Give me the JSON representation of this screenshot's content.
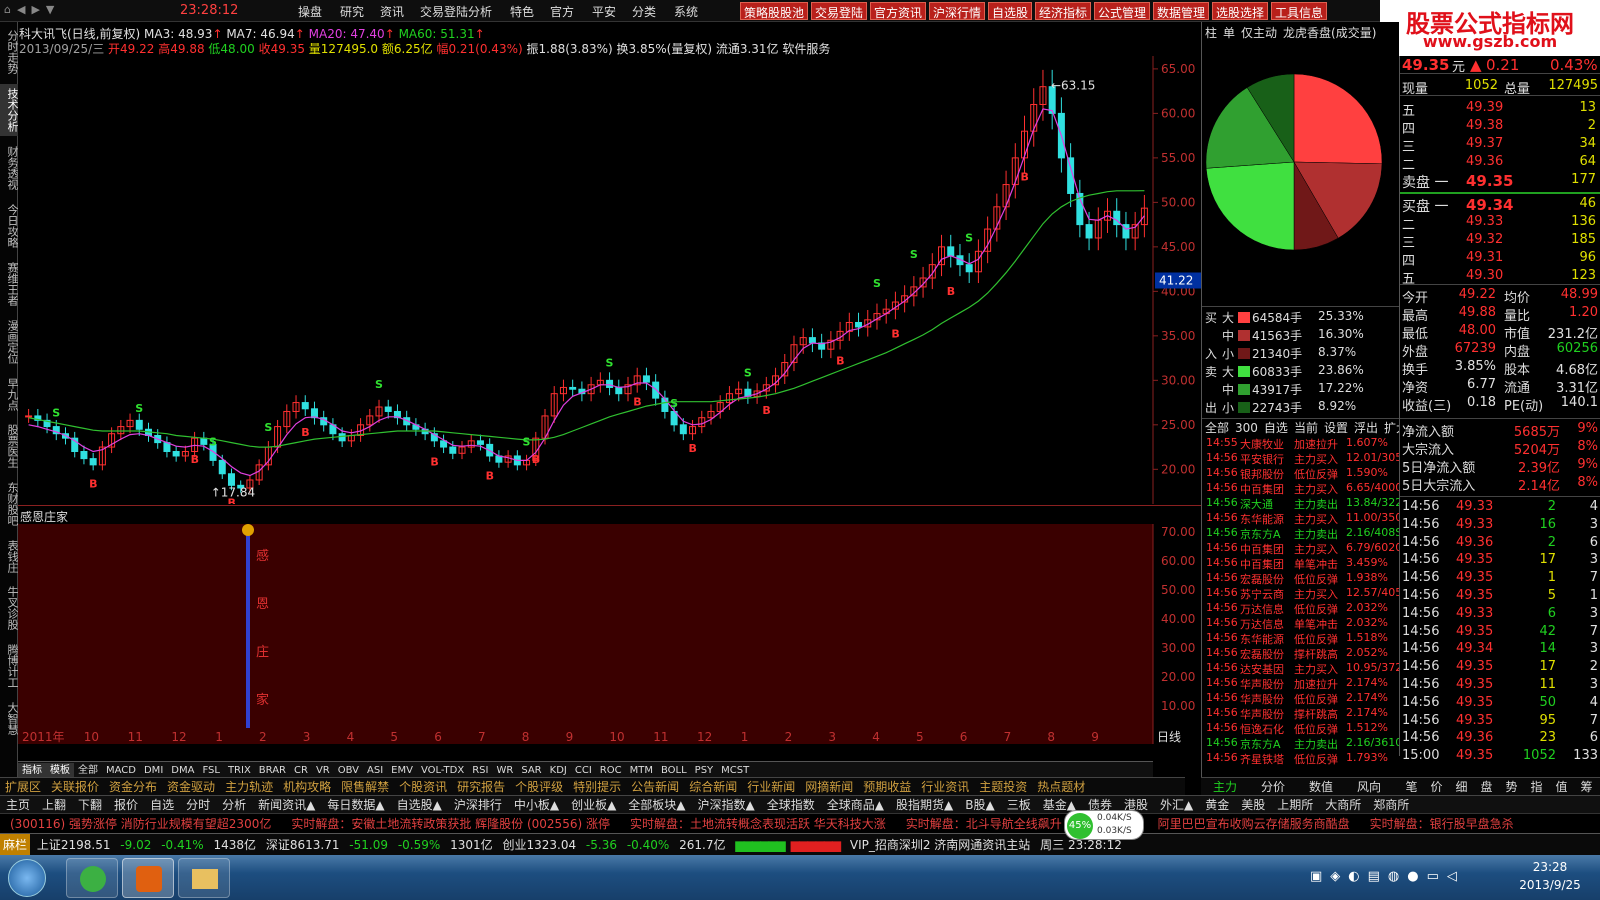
{
  "menubar": {
    "clock": "23:28:12",
    "items": [
      "操盘",
      "研究",
      "资讯",
      "交易登陆分析",
      "特色",
      "官方",
      "平安",
      "分类",
      "系统"
    ],
    "tools": [
      "策略股股池",
      "交易登陆",
      "官方资讯",
      "沪深行情",
      "自选股",
      "经济指标",
      "公式管理",
      "数据管理",
      "选股选择",
      "工具信息"
    ]
  },
  "watermark": {
    "line1": "股票公式指标网",
    "line2": "www.gszb.com"
  },
  "left_tabs": [
    "分时走势",
    "技术分析",
    "财务透视",
    "今日攻略",
    "赛维王者",
    "漫画定位",
    "早九点",
    "股票医生",
    "东财股吧",
    "表钱庄",
    "牛叉诊股",
    "腾博计工",
    "大智慧"
  ],
  "stock": {
    "title": "科大讯飞(日线,前复权)",
    "ma3": "MA3: 48.93",
    "ma7": "MA7: 46.94",
    "ma20": "MA20: 47.40",
    "ma60": "MA60: 51.31",
    "date": "2013/09/25/三",
    "open": "开49.22",
    "high": "高49.88",
    "low": "低48.00",
    "close": "收49.35",
    "volume": "量127495.0",
    "amount": "额6.25亿",
    "range": "幅0.21(0.43%)",
    "extra": "振1.88(3.83%) 换3.85%(量复权) 流通3.31亿 软件服务"
  },
  "chart_data": {
    "type": "line",
    "title": "科大讯飞(日线,前复权)",
    "y_ticks": [
      "65.00",
      "60.00",
      "55.00",
      "50.00",
      "45.00",
      "40.00",
      "35.00",
      "30.00",
      "25.00",
      "20.00"
    ],
    "ylim": [
      17,
      66
    ],
    "x_labels": [
      "2011年",
      "10",
      "11",
      "12",
      "1",
      "2",
      "3",
      "4",
      "5",
      "6",
      "7",
      "8",
      "9",
      "10",
      "11",
      "12",
      "1",
      "2",
      "3",
      "4",
      "5",
      "6",
      "7",
      "8",
      "9"
    ],
    "max_label": "63.15",
    "min_label": "17.84",
    "current_price": "41.22",
    "close_series": [
      26.0,
      25.5,
      24.8,
      24.0,
      23.5,
      22.0,
      21.2,
      20.5,
      22.5,
      24.0,
      24.8,
      25.5,
      24.5,
      23.8,
      23.0,
      22.0,
      21.5,
      22.0,
      23.5,
      22.8,
      21.0,
      19.5,
      18.2,
      17.9,
      18.8,
      20.5,
      22.5,
      24.8,
      26.5,
      27.5,
      26.8,
      25.8,
      25.0,
      24.0,
      23.2,
      23.8,
      25.0,
      26.0,
      27.0,
      26.5,
      25.8,
      25.0,
      24.5,
      24.0,
      23.2,
      22.5,
      21.8,
      22.5,
      23.2,
      22.8,
      21.5,
      20.8,
      21.5,
      20.5,
      21.0,
      23.5,
      26.0,
      28.5,
      29.2,
      29.0,
      28.5,
      29.5,
      30.0,
      29.2,
      28.5,
      29.5,
      30.5,
      29.8,
      28.0,
      26.5,
      25.0,
      24.0,
      24.8,
      25.8,
      26.5,
      27.5,
      28.5,
      29.0,
      28.2,
      28.8,
      29.5,
      30.5,
      32.0,
      34.0,
      34.8,
      34.2,
      33.5,
      34.5,
      35.5,
      36.5,
      36.0,
      36.8,
      37.5,
      38.0,
      38.8,
      39.5,
      40.5,
      41.5,
      43.0,
      45.0,
      44.0,
      43.0,
      42.2,
      44.5,
      47.0,
      49.5,
      52.0,
      55.0,
      58.0,
      61.0,
      63.0,
      60.0,
      55.0,
      51.0,
      47.5,
      46.0,
      48.0,
      49.0,
      47.5,
      46.0,
      47.5,
      49.35
    ],
    "ma_series": [
      25.0,
      24.8,
      24.5,
      24.2,
      23.8,
      23.2,
      22.5,
      22.0,
      22.2,
      22.8,
      23.4,
      23.9,
      24.0,
      23.8,
      23.4,
      23.0,
      22.6,
      22.5,
      22.7,
      22.6,
      22.0,
      21.2,
      20.3,
      19.6,
      19.3,
      19.8,
      20.9,
      22.4,
      23.9,
      25.1,
      25.8,
      25.9,
      25.6,
      25.0,
      24.3,
      24.1,
      24.3,
      24.8,
      25.5,
      25.9,
      25.9,
      25.5,
      25.0,
      24.5,
      23.9,
      23.3,
      22.7,
      22.6,
      22.7,
      22.6,
      22.1,
      21.5,
      21.3,
      21.0,
      21.0,
      21.9,
      23.5,
      25.5,
      27.2,
      28.2,
      28.6,
      29.0,
      29.5,
      29.5,
      29.2,
      29.3,
      29.7,
      29.7,
      29.0,
      27.9,
      26.6,
      25.4,
      25.0,
      25.1,
      25.6,
      26.4,
      27.3,
      28.0,
      28.2,
      28.5,
      29.0,
      29.7,
      30.8,
      32.3,
      33.6,
      34.2,
      34.1,
      34.3,
      34.8,
      35.6,
      35.8,
      36.3,
      36.9,
      37.5,
      38.2,
      38.9,
      39.8,
      40.8,
      42.0,
      43.6,
      44.0,
      43.6,
      43.1,
      43.6,
      45.2,
      47.3,
      49.6,
      52.3,
      55.2,
      58.2,
      60.5,
      60.3,
      57.5,
      53.9,
      50.4,
      48.1,
      48.0,
      48.5,
      48.0,
      47.0,
      47.2,
      48.5
    ],
    "ma60_series": [
      25.8,
      25.6,
      25.4,
      25.2,
      25.0,
      24.8,
      24.6,
      24.4,
      24.3,
      24.3,
      24.3,
      24.3,
      24.3,
      24.2,
      24.1,
      24.0,
      23.8,
      23.7,
      23.6,
      23.5,
      23.4,
      23.2,
      23.0,
      22.8,
      22.6,
      22.5,
      22.5,
      22.6,
      22.8,
      23.0,
      23.2,
      23.4,
      23.5,
      23.6,
      23.7,
      23.8,
      23.9,
      24.0,
      24.1,
      24.2,
      24.3,
      24.3,
      24.3,
      24.3,
      24.3,
      24.2,
      24.1,
      24.0,
      23.9,
      23.8,
      23.7,
      23.6,
      23.5,
      23.4,
      23.3,
      23.3,
      23.4,
      23.6,
      23.9,
      24.3,
      24.7,
      25.1,
      25.5,
      25.9,
      26.2,
      26.5,
      26.8,
      27.1,
      27.3,
      27.5,
      27.6,
      27.6,
      27.6,
      27.6,
      27.6,
      27.7,
      27.8,
      27.9,
      28.0,
      28.1,
      28.3,
      28.5,
      28.8,
      29.1,
      29.5,
      29.9,
      30.3,
      30.7,
      31.1,
      31.5,
      31.9,
      32.3,
      32.7,
      33.1,
      33.6,
      34.1,
      34.6,
      35.1,
      35.7,
      36.4,
      37.0,
      37.6,
      38.2,
      38.9,
      39.8,
      40.9,
      42.1,
      43.4,
      44.8,
      46.2,
      47.6,
      48.7,
      49.5,
      50.1,
      50.5,
      50.8,
      51.0,
      51.2,
      51.3,
      51.3,
      51.3,
      51.31
    ],
    "signals_s": [
      3,
      12,
      20,
      26,
      38,
      54,
      63,
      70,
      78,
      92,
      96,
      102
    ],
    "signals_b": [
      7,
      18,
      22,
      30,
      44,
      50,
      55,
      66,
      72,
      80,
      88,
      94,
      100,
      108
    ]
  },
  "indicator": {
    "name": "感恩庄家",
    "y_ticks": [
      "70.00",
      "60.00",
      "50.00",
      "40.00",
      "30.00",
      "20.00",
      "10.00"
    ],
    "vertical_text": [
      "感",
      "恩",
      "庄",
      "家"
    ]
  },
  "index_tabs": [
    "指标",
    "模板",
    "全部",
    "MACD",
    "DMI",
    "DMA",
    "FSL",
    "TRIX",
    "BRAR",
    "CR",
    "VR",
    "OBV",
    "ASI",
    "EMV",
    "VOL-TDX",
    "RSI",
    "WR",
    "SAR",
    "KDJ",
    "CCI",
    "ROC",
    "MTM",
    "BOLL",
    "PSY",
    "MCST"
  ],
  "func_bar": [
    "扩展区",
    "关联报价",
    "资金分布",
    "资金驱动",
    "主力轨迹",
    "机构攻略",
    "限售解禁",
    "个股资讯",
    "研究报告",
    "个股评级",
    "特别提示",
    "公告新闻",
    "综合新闻",
    "行业新闻",
    "网摘新闻",
    "预期收益",
    "行业资讯",
    "主题投资",
    "热点题材"
  ],
  "nav_bar": [
    "主页",
    "上翻",
    "下翻",
    "报价",
    "自选",
    "分时",
    "分析",
    "新闻资讯▲",
    "每日数据▲",
    "自选股▲",
    "沪深排行",
    "中小板▲",
    "创业板▲",
    "全部板块▲",
    "沪深指数▲",
    "全球指数",
    "全球商品▲",
    "股指期货▲",
    "B股▲",
    "三板",
    "基金▲",
    "债券",
    "港股",
    "外汇▲",
    "黄金",
    "美股",
    "上期所",
    "大商所",
    "郑商所"
  ],
  "news": [
    "(300116) 强势涨停 消防行业规模有望超2300亿",
    "实时解盘：安徽土地流转政策获批 辉隆股份 (002556) 涨停",
    "实时解盘：土地流转概念表现活跃 华天科技大涨",
    "实时解盘：北斗导航全线飙升 北斗星通涨停",
    "阿里巴巴宣布收购云存储服务商酷盘",
    "实时解盘：银行股早盘急杀"
  ],
  "status": {
    "brand": "麻栏",
    "sh": "上证2198.51",
    "sh_chg": "-9.02",
    "sh_pct": "-0.41%",
    "sh_amt": "1438亿",
    "sz": "深证8613.71",
    "sz_chg": "-51.09",
    "sz_pct": "-0.59%",
    "sz_amt": "1301亿",
    "cy": "创业1323.04",
    "cy_chg": "-5.36",
    "cy_pct": "-0.40%",
    "cy_amt": "261.7亿",
    "server": "VIP_招商深圳2 济南网通资讯主站",
    "time": "周三 23:28:12",
    "net_up": "0.04K/S",
    "net_down": "0.03K/S",
    "cpu": "45%"
  },
  "taskbar": {
    "time": "23:28",
    "date": "2013/9/25"
  },
  "rightpanel": {
    "tabs": [
      "柱",
      "单",
      "仅主动",
      "龙虎香盘(成交量)"
    ],
    "flow": [
      {
        "side": "买",
        "size": "大",
        "val": "64584手",
        "pct": "25.33%",
        "color": "#ff4040"
      },
      {
        "side": "",
        "size": "中",
        "val": "41563手",
        "pct": "16.30%",
        "color": "#b03030"
      },
      {
        "side": "入",
        "size": "小",
        "val": "21340手",
        "pct": "8.37%",
        "color": "#701818"
      },
      {
        "side": "卖",
        "size": "大",
        "val": "60833手",
        "pct": "23.86%",
        "color": "#40e040"
      },
      {
        "side": "",
        "size": "中",
        "val": "43917手",
        "pct": "17.22%",
        "color": "#30a030"
      },
      {
        "side": "出",
        "size": "小",
        "val": "22743手",
        "pct": "8.92%",
        "color": "#186018"
      }
    ],
    "pie": [
      25.33,
      16.3,
      8.37,
      23.86,
      17.22,
      8.92
    ],
    "list_tabs": [
      "全部",
      "300",
      "自选",
      "当前",
      "设置",
      "浮出",
      "扩大"
    ],
    "trades": [
      [
        "14:55",
        "大康牧业",
        "加速拉升",
        "1.607%",
        "red"
      ],
      [
        "14:56",
        "平安银行",
        "主力买入",
        "12.01/305",
        "red"
      ],
      [
        "14:56",
        "银邦股份",
        "低位反弹",
        "1.590%",
        "red"
      ],
      [
        "14:56",
        "中百集团",
        "主力买入",
        "6.65/4000",
        "red"
      ],
      [
        "14:56",
        "深大通",
        "主力卖出",
        "13.84/322",
        "green"
      ],
      [
        "14:56",
        "东华能源",
        "主力买入",
        "11.00/350",
        "red"
      ],
      [
        "14:56",
        "京东方A",
        "主力卖出",
        "2.16/408S",
        "green"
      ],
      [
        "14:56",
        "中百集团",
        "主力买入",
        "6.79/6020",
        "red"
      ],
      [
        "14:56",
        "中百集团",
        "单笔冲击",
        "3.459%",
        "red"
      ],
      [
        "14:56",
        "宏磊股份",
        "低位反弹",
        "1.938%",
        "red"
      ],
      [
        "14:56",
        "苏宁云商",
        "主力买入",
        "12.57/405",
        "red"
      ],
      [
        "14:56",
        "万达信息",
        "低位反弹",
        "2.032%",
        "red"
      ],
      [
        "14:56",
        "万达信息",
        "单笔冲击",
        "2.032%",
        "red"
      ],
      [
        "14:56",
        "东华能源",
        "低位反弹",
        "1.518%",
        "red"
      ],
      [
        "14:56",
        "宏磊股份",
        "撑杆跳高",
        "2.052%",
        "red"
      ],
      [
        "14:56",
        "达安基因",
        "主力买入",
        "10.95/372",
        "red"
      ],
      [
        "14:56",
        "华声股份",
        "加速拉升",
        "2.174%",
        "red"
      ],
      [
        "14:56",
        "华声股份",
        "低位反弹",
        "2.174%",
        "red"
      ],
      [
        "14:56",
        "华声股份",
        "撑杆跳高",
        "2.174%",
        "red"
      ],
      [
        "14:56",
        "恒逸石化",
        "低位反弹",
        "1.512%",
        "red"
      ],
      [
        "14:56",
        "京东方A",
        "主力卖出",
        "2.16/3610",
        "green"
      ],
      [
        "14:56",
        "齐星铁塔",
        "低位反弹",
        "1.793%",
        "red"
      ]
    ],
    "bottom_tabs": [
      "主力",
      "分价",
      "数值",
      "风向"
    ]
  },
  "quote": {
    "price": "49.35",
    "chg": "0.21",
    "pct": "0.43%",
    "now_hand_label": "现量",
    "now_hand": "1052",
    "total_label": "总量",
    "total": "127495",
    "asks": [
      [
        "五",
        "49.39",
        "13"
      ],
      [
        "四",
        "49.38",
        "2"
      ],
      [
        "三",
        "49.37",
        "34"
      ],
      [
        "二",
        "49.36",
        "64"
      ],
      [
        "卖盘 一",
        "49.35",
        "177"
      ]
    ],
    "bids": [
      [
        "买盘 一",
        "49.34",
        "46"
      ],
      [
        "二",
        "49.33",
        "136"
      ],
      [
        "三",
        "49.32",
        "185"
      ],
      [
        "四",
        "49.31",
        "96"
      ],
      [
        "五",
        "49.30",
        "123"
      ]
    ],
    "stats": [
      [
        "今开",
        "49.22",
        "均价",
        "48.99"
      ],
      [
        "最高",
        "49.88",
        "量比",
        "1.20"
      ],
      [
        "最低",
        "48.00",
        "市值",
        "231.2亿"
      ],
      [
        "外盘",
        "67239",
        "内盘",
        "60256"
      ],
      [
        "换手",
        "3.85%",
        "股本",
        "4.68亿"
      ],
      [
        "净资",
        "6.77",
        "流通",
        "3.31亿"
      ],
      [
        "收益(三)",
        "0.18",
        "PE(动)",
        "140.1"
      ]
    ],
    "flows": [
      [
        "净流入额",
        "5685万",
        "9%"
      ],
      [
        "大宗流入",
        "5204万",
        "8%"
      ],
      [
        "5日净流入额",
        "2.39亿",
        "9%"
      ],
      [
        "5日大宗流入",
        "2.14亿",
        "8%"
      ]
    ],
    "ticks": [
      [
        "14:56",
        "49.33",
        "2",
        "4"
      ],
      [
        "14:56",
        "49.33",
        "16",
        "3"
      ],
      [
        "14:56",
        "49.36",
        "2",
        "6"
      ],
      [
        "14:56",
        "49.35",
        "17",
        "3"
      ],
      [
        "14:56",
        "49.35",
        "1",
        "7"
      ],
      [
        "14:56",
        "49.35",
        "5",
        "1"
      ],
      [
        "14:56",
        "49.33",
        "6",
        "3"
      ],
      [
        "14:56",
        "49.35",
        "42",
        "7"
      ],
      [
        "14:56",
        "49.34",
        "14",
        "3"
      ],
      [
        "14:56",
        "49.35",
        "17",
        "2"
      ],
      [
        "14:56",
        "49.35",
        "11",
        "3"
      ],
      [
        "14:56",
        "49.35",
        "50",
        "4"
      ],
      [
        "14:56",
        "49.35",
        "95",
        "7"
      ],
      [
        "14:56",
        "49.36",
        "23",
        "6"
      ],
      [
        "15:00",
        "49.35",
        "1052",
        "133"
      ]
    ],
    "bottom_tabs": [
      "笔",
      "价",
      "细",
      "盘",
      "势",
      "指",
      "值",
      "筹"
    ]
  }
}
